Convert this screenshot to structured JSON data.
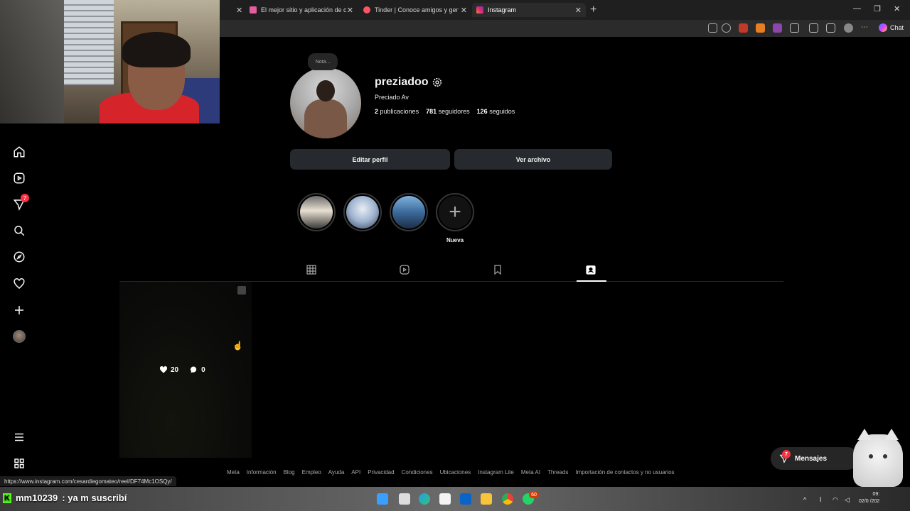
{
  "browser": {
    "tabs": [
      {
        "label": "El mejor sitio y aplicación de citas",
        "color": "#e55da0"
      },
      {
        "label": "Tinder | Conoce amigos y gente nueva",
        "color": "#fd5564"
      },
      {
        "label": "Instagram",
        "color": "#e1306c"
      }
    ],
    "chat_label": "Chat",
    "status_url": "https://www.instagram.com/cesardiegomateo/reel/DF74Mc1OSQy/"
  },
  "sidebar": {
    "notifications_badge": "7"
  },
  "profile": {
    "note": "Nota...",
    "username": "preziadoo",
    "full_name": "Preciado Av",
    "posts_count": "2",
    "posts_label": "publicaciones",
    "followers_count": "781",
    "followers_label": "seguidores",
    "following_count": "126",
    "following_label": "seguidos",
    "edit_profile_label": "Editar perfil",
    "archive_label": "Ver archivo",
    "new_highlight_label": "Nueva"
  },
  "post": {
    "likes": "20",
    "comments": "0"
  },
  "footer": {
    "links": [
      "Meta",
      "Información",
      "Blog",
      "Empleo",
      "Ayuda",
      "API",
      "Privacidad",
      "Condiciones",
      "Ubicaciones",
      "Instagram Lite",
      "Meta AI",
      "Threads",
      "Importación de contactos y no usuarios"
    ]
  },
  "messages": {
    "label": "Mensajes",
    "badge": "7"
  },
  "stream_chat": {
    "user": "mm10239",
    "message": ": ya m suscribí"
  },
  "taskbar": {
    "whatsapp_badge": "60",
    "clock_time": "09:",
    "clock_date": "02/0 /202"
  },
  "colors": {
    "background": "#000000",
    "accent_red": "#ff3040",
    "button_bg": "#262a2f"
  }
}
